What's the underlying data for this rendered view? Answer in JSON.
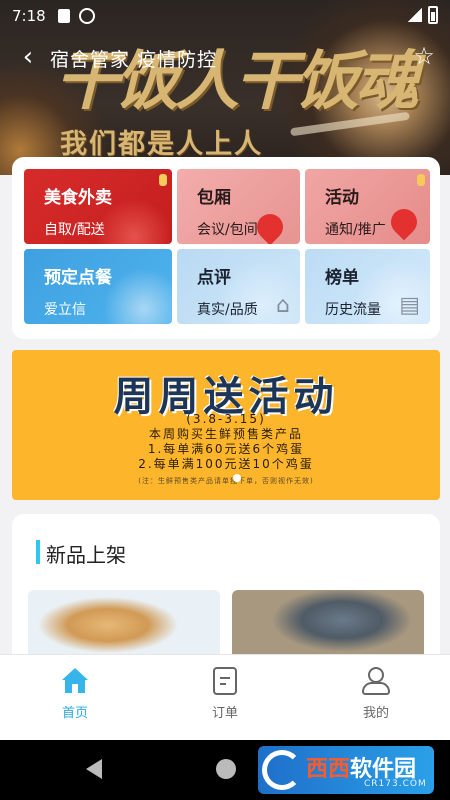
{
  "status_bar": {
    "time": "7:18"
  },
  "nav": {
    "title": "宿舍管家 疫情防控"
  },
  "hero": {
    "calligraphy": "干饭人干饭魂",
    "subtitle": "我们都是人上人"
  },
  "categories": [
    {
      "title": "美食外卖",
      "subtitle": "自取/配送"
    },
    {
      "title": "包厢",
      "subtitle": "会议/包间"
    },
    {
      "title": "活动",
      "subtitle": "通知/推广"
    },
    {
      "title": "预定点餐",
      "subtitle": "爱立信"
    },
    {
      "title": "点评",
      "subtitle": "真实/品质"
    },
    {
      "title": "榜单",
      "subtitle": "历史流量"
    }
  ],
  "promo": {
    "title": "周周送活动",
    "date_range": "(3.8-3.15)",
    "line1": "本周购买生鲜预售类产品",
    "line2": "1.每单满60元送6个鸡蛋",
    "line3": "2.每单满100元送10个鸡蛋",
    "note": "(注：生鲜预售类产品请单独下单，否则视作无效)"
  },
  "section": {
    "title": "新品上架"
  },
  "tabs": [
    {
      "label": "首页",
      "active": true
    },
    {
      "label": "订单",
      "active": false
    },
    {
      "label": "我的",
      "active": false
    }
  ],
  "watermark": {
    "brand_a": "西西",
    "brand_b": "软件园",
    "url": "CR173.COM"
  },
  "colors": {
    "accent": "#2aa8e0",
    "promo_bg": "#fdb52b",
    "food_red": "#d72b2b"
  }
}
